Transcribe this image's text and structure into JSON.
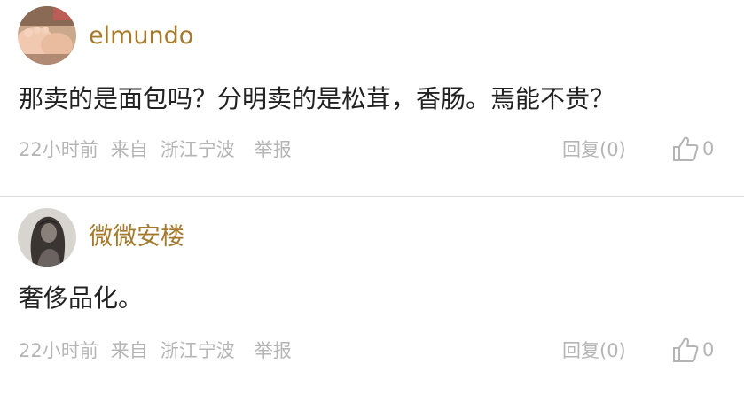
{
  "comments": [
    {
      "username": "elmundo",
      "avatar_icon": "baby-feet-avatar",
      "content": "那卖的是面包吗？分明卖的是松茸，香肠。焉能不贵？",
      "time": "22小时前",
      "from_label": "来自",
      "location": "浙江宁波",
      "report_label": "举报",
      "reply_label": "回复(0)",
      "like_icon": "thumbs-up-icon",
      "like_count": "0"
    },
    {
      "username": "微微安楼",
      "avatar_icon": "girl-long-hair-avatar",
      "content": "奢侈品化。",
      "time": "22小时前",
      "from_label": "来自",
      "location": "浙江宁波",
      "report_label": "举报",
      "reply_label": "回复(0)",
      "like_icon": "thumbs-up-icon",
      "like_count": "0"
    }
  ],
  "colors": {
    "username": "#a57a2c",
    "content": "#222222",
    "meta": "#b5b5b5",
    "divider": "#dcdcdc"
  }
}
